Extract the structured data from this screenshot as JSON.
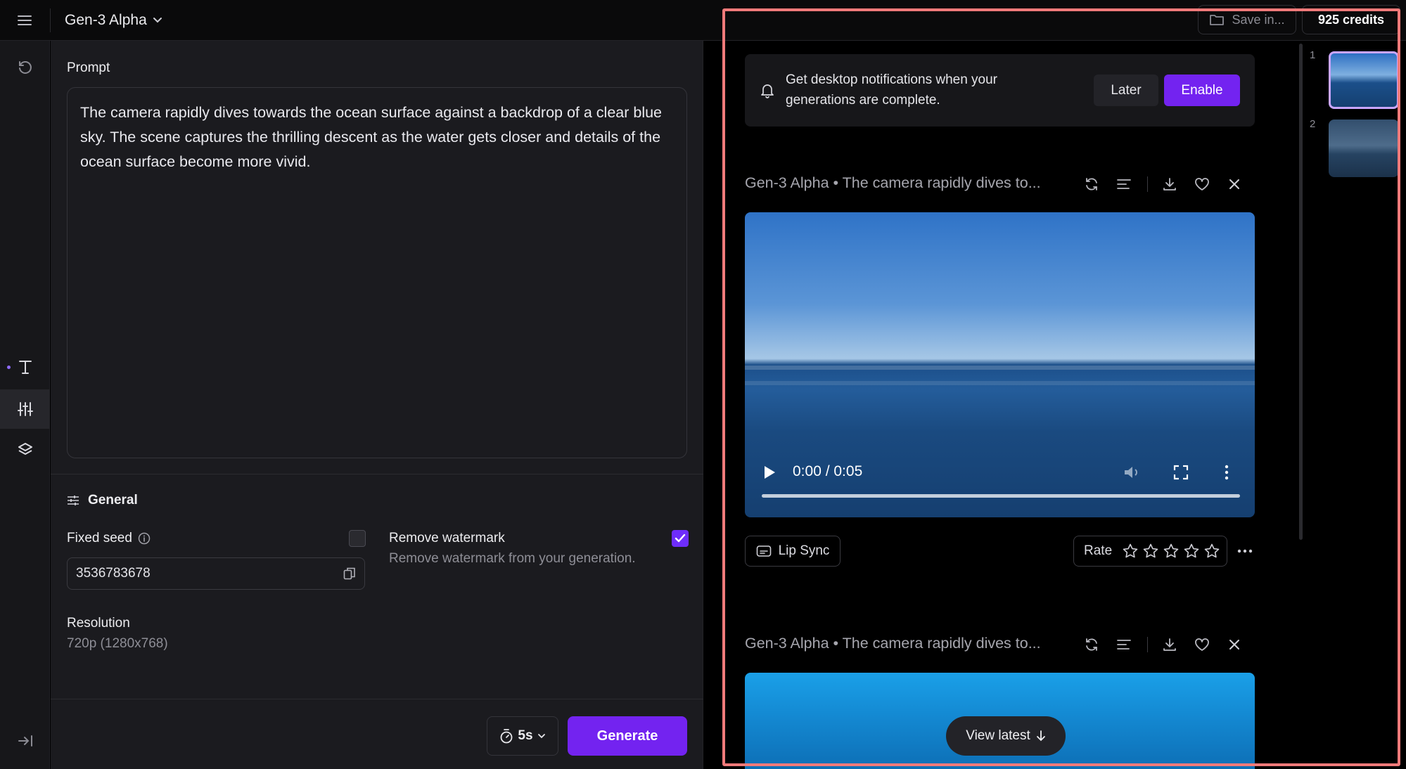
{
  "header": {
    "model_name": "Gen-3 Alpha",
    "save_label": "Save in...",
    "credits": "925 credits"
  },
  "rail": {
    "icons": [
      "menu-icon",
      "history-icon",
      "text-icon",
      "sliders-icon",
      "layers-icon",
      "collapse-icon"
    ]
  },
  "prompt": {
    "label": "Prompt",
    "text": "The camera rapidly dives towards the ocean surface against a backdrop of a clear blue sky. The scene captures the thrilling descent as the water gets closer and details of the ocean surface become more vivid."
  },
  "general": {
    "title": "General",
    "fixed_seed_label": "Fixed seed",
    "fixed_seed_checked": false,
    "seed_value": "3536783678",
    "remove_watermark_label": "Remove watermark",
    "remove_watermark_desc": "Remove watermark from your generation.",
    "remove_watermark_checked": true,
    "resolution_label": "Resolution",
    "resolution_value": "720p (1280x768)"
  },
  "footer": {
    "duration": "5s",
    "generate_label": "Generate"
  },
  "notification": {
    "text": "Get desktop notifications when your generations are complete.",
    "later_label": "Later",
    "enable_label": "Enable"
  },
  "generations": [
    {
      "title": "Gen-3 Alpha • The camera rapidly dives to...",
      "time": "0:00 / 0:05",
      "lip_sync_label": "Lip Sync",
      "rate_label": "Rate",
      "rating_stars": 5
    },
    {
      "title": "Gen-3 Alpha • The camera rapidly dives to..."
    }
  ],
  "view_latest_label": "View latest",
  "thumbnails": [
    {
      "number": "1",
      "selected": true
    },
    {
      "number": "2",
      "selected": false
    }
  ],
  "colors": {
    "accent": "#7323f0",
    "highlight_border": "#f07a7a"
  }
}
